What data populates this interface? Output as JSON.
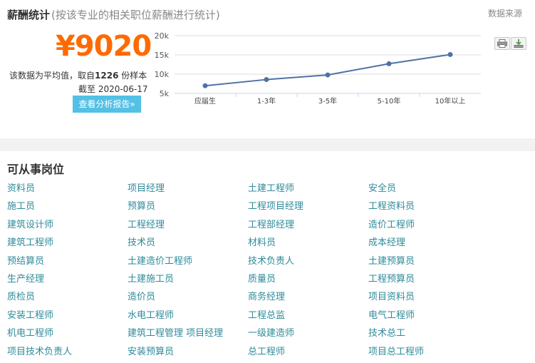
{
  "salary": {
    "title": "薪酬统计",
    "subtitle": "(按该专业的相关职位薪酬进行统计)",
    "source_label": "数据来源",
    "average": "¥9020",
    "note_prefix": "该数据为平均值，取自",
    "sample_count": "1226",
    "note_suffix": "份样本",
    "date_note": "截至 2020-06-17",
    "report_button": "查看分析报告»"
  },
  "chart_data": {
    "type": "line",
    "categories": [
      "应届生",
      "1-3年",
      "3-5年",
      "5-10年",
      "10年以上"
    ],
    "series": [
      {
        "values": [
          7000,
          8600,
          9800,
          12700,
          15100
        ]
      }
    ],
    "yticks": [
      "5k",
      "10k",
      "15k",
      "20k"
    ],
    "ylim": [
      5000,
      20000
    ],
    "line_color": "#4e72a6",
    "grid": true
  },
  "toolbar": {
    "print_icon": "print-icon",
    "download_icon": "download-icon"
  },
  "jobs": {
    "title": "可从事岗位",
    "items": [
      "资料员",
      "项目经理",
      "土建工程师",
      "安全员",
      "施工员",
      "预算员",
      "工程项目经理",
      "工程资料员",
      "建筑设计师",
      "工程经理",
      "工程部经理",
      "造价工程师",
      "建筑工程师",
      "技术员",
      "材料员",
      "成本经理",
      "预结算员",
      "土建造价工程师",
      "技术负责人",
      "土建预算员",
      "生产经理",
      "土建施工员",
      "质量员",
      "工程预算员",
      "质检员",
      "造价员",
      "商务经理",
      "项目资料员",
      "安装工程师",
      "水电工程师",
      "工程总监",
      "电气工程师",
      "机电工程师",
      "建筑工程管理 项目经理",
      "一级建造师",
      "技术总工",
      "项目技术负责人",
      "安装预算员",
      "总工程师",
      "项目总工程师"
    ]
  }
}
